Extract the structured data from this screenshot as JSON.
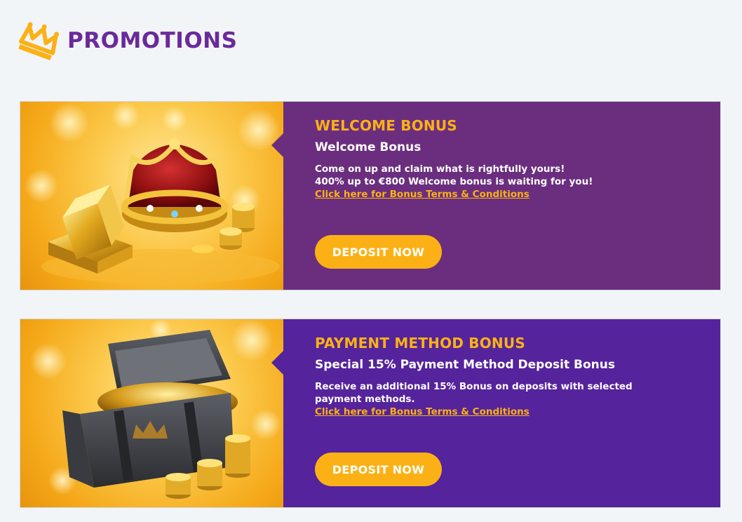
{
  "header": {
    "title": "PROMOTIONS",
    "icon": "crown-icon"
  },
  "colors": {
    "accent": "#fbb116",
    "title": "#6a2a9a",
    "panel_welcome": "#6b2e7e",
    "panel_payment": "#55239c",
    "background": "#f2f5f8"
  },
  "promotions": [
    {
      "heading": "WELCOME BONUS",
      "subtitle": "Welcome Bonus",
      "desc_line1": "Come on up and claim what is rightfully yours!",
      "desc_line2": "400% up to €800 Welcome bonus is waiting for you!",
      "terms_link": "Click here for Bonus Terms & Conditions",
      "button": "DEPOSIT NOW",
      "image_icon": "crown-gold-bars-image"
    },
    {
      "heading": "PAYMENT METHOD BONUS",
      "subtitle": "Special 15% Payment Method Deposit Bonus",
      "desc_line1": "Receive an additional 15% Bonus on deposits with selected",
      "desc_line2": "payment methods.",
      "terms_link": "Click here for Bonus Terms & Conditions",
      "button": "DEPOSIT NOW",
      "image_icon": "treasure-chest-image"
    }
  ]
}
